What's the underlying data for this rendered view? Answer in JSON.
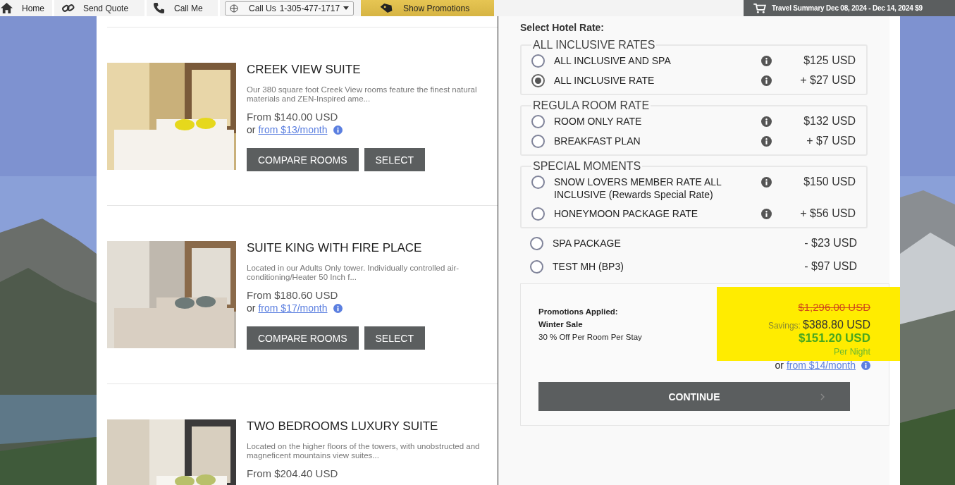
{
  "nav": {
    "items": [
      {
        "label": "Home",
        "kind": "home"
      },
      {
        "label": "Send Quote",
        "kind": "link"
      },
      {
        "label": "Call Me",
        "kind": "phone"
      }
    ],
    "call_us": {
      "label": "Call Us",
      "phone": "1-305-477-1717"
    },
    "promotions": "Show Promotions",
    "travel_summary": "Travel Summary Dec 08, 2024 - Dec 14, 2024 $9"
  },
  "rooms": [
    {
      "title": "CREEK VIEW SUITE",
      "description": "Our 380 square foot Creek View rooms feature the finest natural materials and ZEN-Inspired ame...",
      "price": "From $140.00 USD",
      "monthly_prefix": "or",
      "monthly_link": "from $13/month",
      "buttons": [
        "COMPARE ROOMS",
        "SELECT"
      ]
    },
    {
      "title": "SUITE KING WITH FIRE PLACE",
      "description": "Located in our Adults Only tower.  Individually controlled air-conditioning/Heater 50 Inch f...",
      "price": "From $180.60 USD",
      "monthly_prefix": "or",
      "monthly_link": "from $17/month",
      "buttons": [
        "COMPARE ROOMS",
        "SELECT"
      ]
    },
    {
      "title": "TWO BEDROOMS LUXURY SUITE",
      "description": "Located on the higher floors of the towers, with unobstructed and magneficent mountains view suites...",
      "price": "From $204.40 USD"
    }
  ],
  "rates": {
    "heading": "Select Hotel Rate:",
    "groups": [
      {
        "title": "ALL INCLUSIVE RATES",
        "rates": [
          {
            "label": "ALL INCLUSIVE AND SPA",
            "price": "$125 USD",
            "info": true,
            "selected": false
          },
          {
            "label": "ALL INCLUSIVE RATE",
            "price": "+ $27 USD",
            "info": true,
            "selected": true
          }
        ]
      },
      {
        "title": "REGULA ROOM RATE",
        "rates": [
          {
            "label": "ROOM ONLY RATE",
            "price": "$132 USD",
            "info": true,
            "selected": false
          },
          {
            "label": "BREAKFAST PLAN",
            "price": "+ $7 USD",
            "info": true,
            "selected": false
          }
        ]
      },
      {
        "title": "SPECIAL MOMENTS",
        "rates": [
          {
            "label": "SNOW LOVERS MEMBER RATE ALL INCLUSIVE (Rewards Special Rate)",
            "price": "$150 USD",
            "info": true,
            "selected": false
          },
          {
            "label": "HONEYMOON PACKAGE RATE",
            "price": "+ $56 USD",
            "info": true,
            "selected": false
          }
        ]
      }
    ],
    "other_rates": [
      {
        "label": "SPA PACKAGE",
        "price": "- $23 USD",
        "info": false,
        "selected": false
      },
      {
        "label": "TEST MH (BP3)",
        "price": "- $97 USD",
        "info": false,
        "selected": false
      }
    ]
  },
  "summary": {
    "promotions_label": "Promotions Applied:",
    "promotion_name": "Winter Sale",
    "promotion_detail": "30 % Off Per Room Per Stay",
    "original_price": "$1,296.00 USD",
    "savings_label": "Savings:",
    "savings": "$388.80 USD",
    "total": "$151.20 USD",
    "per_night": "Per Night",
    "monthly_prefix": "or",
    "monthly_link": "from $14/month",
    "continue": "CONTINUE"
  }
}
